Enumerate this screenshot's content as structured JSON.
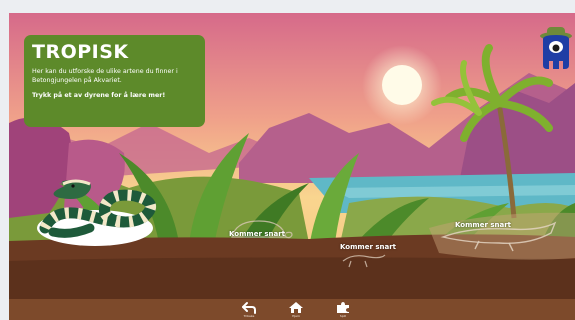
{
  "section": {
    "title": "TROPISK",
    "description": "Her kan du utforske de ulike artene du finner i Betongjungelen på Akvariet.",
    "cta": "Trykk på et av dyrene for å lære mer!"
  },
  "animals": [
    {
      "name": "snake",
      "status": ""
    },
    {
      "name": "turtle",
      "status": "Kommer snart"
    },
    {
      "name": "lizard",
      "status": "Kommer snart"
    },
    {
      "name": "crocodile",
      "status": "Kommer snart"
    }
  ],
  "nav": [
    {
      "icon": "back-arrow-icon",
      "label": "Tilbake"
    },
    {
      "icon": "home-icon",
      "label": "Hjem"
    },
    {
      "icon": "puzzle-icon",
      "label": "Spill"
    }
  ],
  "colors": {
    "panel": "#5d8a2a",
    "ground": "#6b3a22",
    "bar": "#7d4a2b",
    "mascot": "#1f3ea5"
  }
}
